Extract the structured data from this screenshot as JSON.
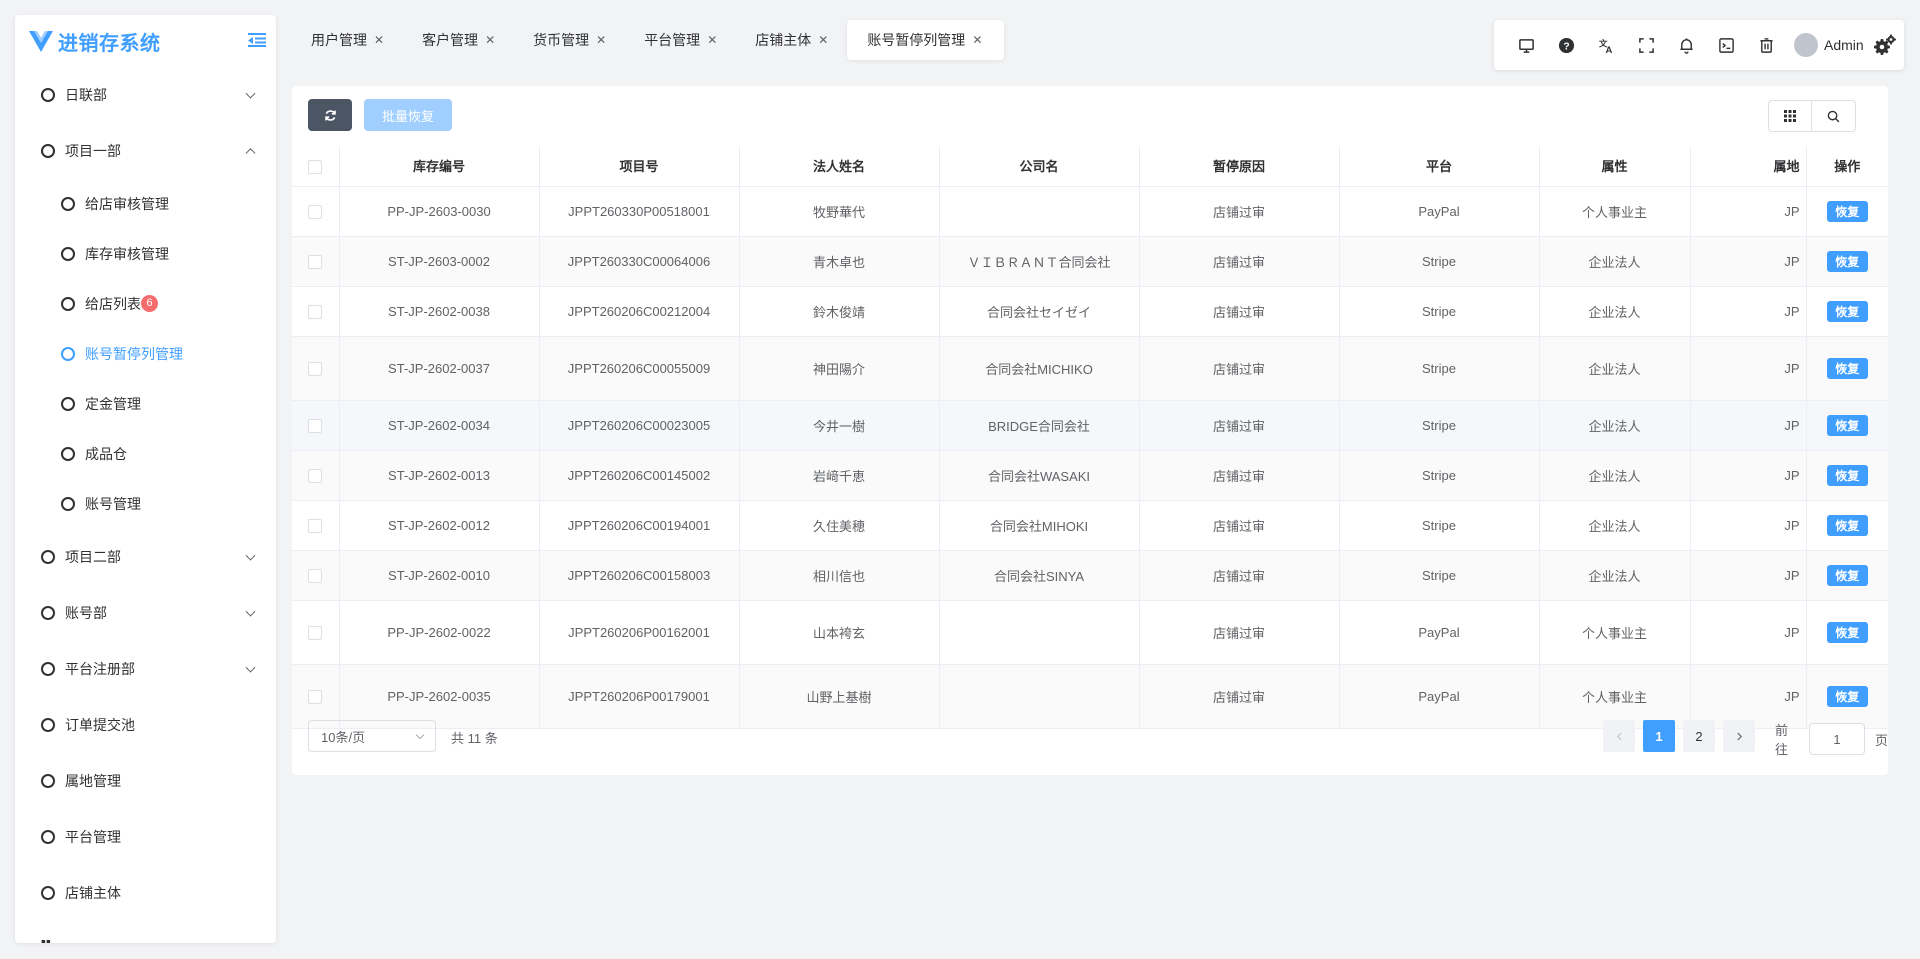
{
  "app": {
    "title": "进销存系统"
  },
  "sidebar": {
    "items": [
      {
        "label": "日联部",
        "expanded": false
      },
      {
        "label": "项目一部",
        "expanded": true,
        "children": [
          {
            "label": "给店审核管理"
          },
          {
            "label": "库存审核管理"
          },
          {
            "label": "给店列表",
            "badge": "6"
          },
          {
            "label": "账号暂停列管理",
            "active": true
          },
          {
            "label": "定金管理"
          },
          {
            "label": "成品仓"
          },
          {
            "label": "账号管理"
          }
        ]
      },
      {
        "label": "项目二部",
        "expanded": false
      },
      {
        "label": "账号部",
        "expanded": false
      },
      {
        "label": "平台注册部",
        "expanded": false
      },
      {
        "label": "订单提交池"
      },
      {
        "label": "属地管理"
      },
      {
        "label": "平台管理"
      },
      {
        "label": "店铺主体"
      }
    ]
  },
  "tabs": [
    {
      "label": "用户管理"
    },
    {
      "label": "客户管理"
    },
    {
      "label": "货币管理"
    },
    {
      "label": "平台管理"
    },
    {
      "label": "店铺主体"
    },
    {
      "label": "账号暂停列管理",
      "active": true
    }
  ],
  "topbar": {
    "username": "Admin"
  },
  "toolbar": {
    "batch_restore_label": "批量恢复"
  },
  "table": {
    "columns": [
      "库存编号",
      "项目号",
      "法人姓名",
      "公司名",
      "暂停原因",
      "平台",
      "属性",
      "属地",
      "操作"
    ],
    "action_label": "恢复",
    "rows": [
      {
        "stock_no": "PP-JP-2603-0030",
        "project_no": "JPPT260330P00518001",
        "legal_name": "牧野華代",
        "company": "",
        "reason": "店铺过审",
        "platform": "PayPal",
        "attribute": "个人事业主",
        "location": "JP"
      },
      {
        "stock_no": "ST-JP-2603-0002",
        "project_no": "JPPT260330C00064006",
        "legal_name": "青木卓也",
        "company": "ＶＩＢＲＡＮＴ合同会社",
        "reason": "店铺过审",
        "platform": "Stripe",
        "attribute": "企业法人",
        "location": "JP"
      },
      {
        "stock_no": "ST-JP-2602-0038",
        "project_no": "JPPT260206C00212004",
        "legal_name": "鈴木俊靖",
        "company": "合同会社セイゼイ",
        "reason": "店铺过审",
        "platform": "Stripe",
        "attribute": "企业法人",
        "location": "JP"
      },
      {
        "stock_no": "ST-JP-2602-0037",
        "project_no": "JPPT260206C00055009",
        "legal_name": "神田陽介",
        "company": "合同会社MICHIKO",
        "reason": "店铺过审",
        "platform": "Stripe",
        "attribute": "企业法人",
        "location": "JP"
      },
      {
        "stock_no": "ST-JP-2602-0034",
        "project_no": "JPPT260206C00023005",
        "legal_name": "今井一樹",
        "company": "BRIDGE合同会社",
        "reason": "店铺过审",
        "platform": "Stripe",
        "attribute": "企业法人",
        "location": "JP"
      },
      {
        "stock_no": "ST-JP-2602-0013",
        "project_no": "JPPT260206C00145002",
        "legal_name": "岩﨑千恵",
        "company": "合同会社WASAKI",
        "reason": "店铺过审",
        "platform": "Stripe",
        "attribute": "企业法人",
        "location": "JP"
      },
      {
        "stock_no": "ST-JP-2602-0012",
        "project_no": "JPPT260206C00194001",
        "legal_name": "久住美穂",
        "company": "合同会社MIHOKI",
        "reason": "店铺过审",
        "platform": "Stripe",
        "attribute": "企业法人",
        "location": "JP"
      },
      {
        "stock_no": "ST-JP-2602-0010",
        "project_no": "JPPT260206C00158003",
        "legal_name": "相川信也",
        "company": "合同会社SINYA",
        "reason": "店铺过审",
        "platform": "Stripe",
        "attribute": "企业法人",
        "location": "JP"
      },
      {
        "stock_no": "PP-JP-2602-0022",
        "project_no": "JPPT260206P00162001",
        "legal_name": "山本袴玄",
        "company": "",
        "reason": "店铺过审",
        "platform": "PayPal",
        "attribute": "个人事业主",
        "location": "JP"
      },
      {
        "stock_no": "PP-JP-2602-0035",
        "project_no": "JPPT260206P00179001",
        "legal_name": "山野上基樹",
        "company": "",
        "reason": "店铺过审",
        "platform": "PayPal",
        "attribute": "个人事业主",
        "location": "JP"
      }
    ]
  },
  "pagination": {
    "page_size": "10条/页",
    "total_text": "共 11 条",
    "pages": [
      "1",
      "2"
    ],
    "current_page": "1",
    "goto_label": "前往",
    "goto_value": "1",
    "page_suffix": "页"
  },
  "colors": {
    "primary": "#409eff",
    "badge": "#f56c6c",
    "refresh_button": "#4b5563",
    "batch_disabled": "#a0cfff"
  }
}
